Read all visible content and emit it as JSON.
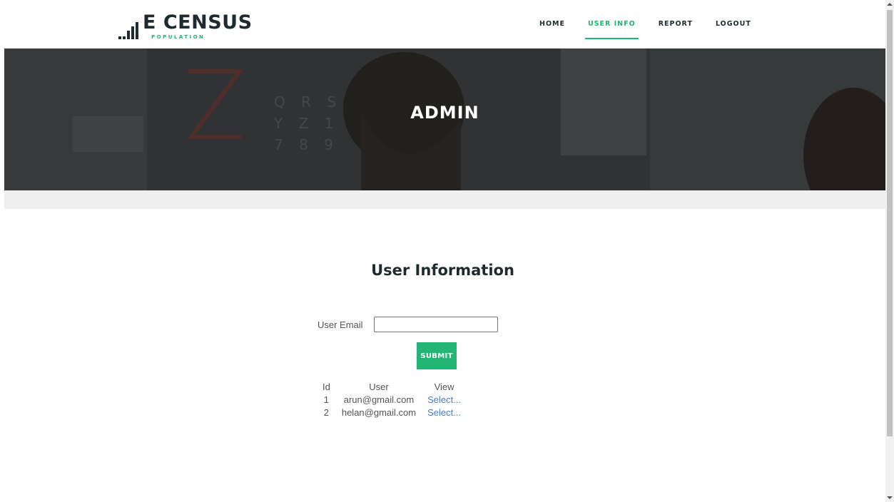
{
  "brand": {
    "title": "E CENSUS",
    "subtitle": "POPULATION"
  },
  "nav": [
    {
      "label": "HOME",
      "active": false
    },
    {
      "label": "USER INFO",
      "active": true
    },
    {
      "label": "REPORT",
      "active": false
    },
    {
      "label": "LOGOUT",
      "active": false
    }
  ],
  "banner": {
    "title": "ADMIN"
  },
  "main": {
    "title": "User Information",
    "email_label": "User Email",
    "email_value": "",
    "submit_label": "SUBMIT",
    "table": {
      "headers": [
        "Id",
        "User",
        "View"
      ],
      "rows": [
        {
          "id": "1",
          "user": "arun@gmail.com",
          "view": "Select..."
        },
        {
          "id": "2",
          "user": "helan@gmail.com",
          "view": "Select..."
        }
      ]
    }
  },
  "colors": {
    "accent": "#22b573",
    "dark": "#1f2a2e",
    "link": "#4a7dbf"
  }
}
